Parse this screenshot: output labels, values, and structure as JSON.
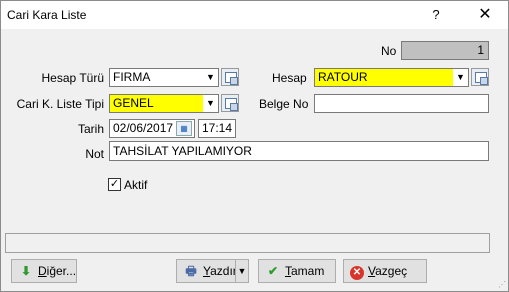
{
  "window": {
    "title": "Cari Kara Liste",
    "help": "?",
    "close": "✕"
  },
  "form": {
    "no": {
      "label": "No",
      "value": "1"
    },
    "hesap_turu": {
      "label": "Hesap Türü",
      "value": "FIRMA"
    },
    "hesap": {
      "label": "Hesap",
      "value": "RATOUR"
    },
    "cari_liste_tipi": {
      "label": "Cari K. Liste Tipi",
      "value": "GENEL"
    },
    "belge_no": {
      "label": "Belge No",
      "value": ""
    },
    "tarih": {
      "label": "Tarih",
      "date": "02/06/2017",
      "time": "17:14"
    },
    "not": {
      "label": "Not",
      "value": "TAHSİLAT YAPILAMIYOR"
    },
    "aktif": {
      "label": "Aktif",
      "checked": true
    }
  },
  "buttons": {
    "diger": {
      "first": "D",
      "rest": "iğer..."
    },
    "yazdir": {
      "first": "Y",
      "rest": "azdır"
    },
    "tamam": {
      "first": "T",
      "rest": "amam"
    },
    "vazgec": {
      "first": "V",
      "rest": "azgeç"
    }
  },
  "colors": {
    "highlight": "#ffff00",
    "no_field": "#c0c0c0"
  },
  "icons": [
    "lookup-icon",
    "calendar-icon",
    "arrow-down-icon",
    "printer-icon",
    "checkmark-icon",
    "cancel-icon"
  ]
}
